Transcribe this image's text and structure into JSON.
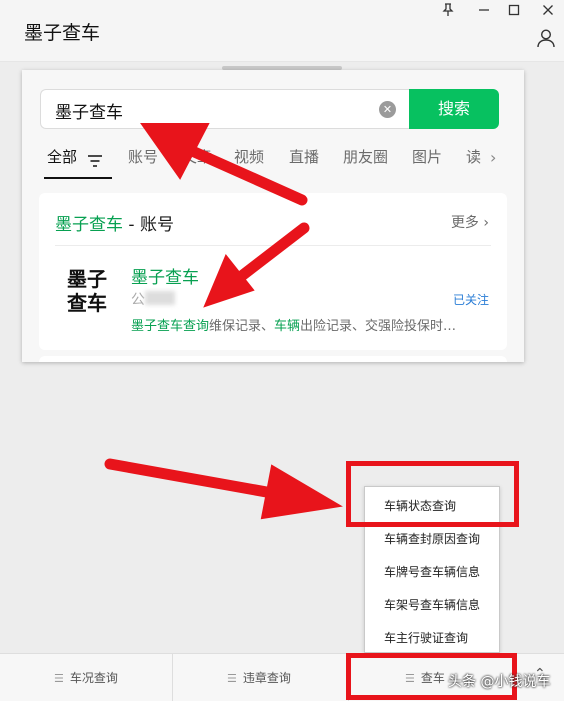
{
  "window": {
    "title": "墨子查车",
    "controls": {
      "pin": "⊥",
      "minimize": "—",
      "maximize": "☐",
      "close": "✕"
    }
  },
  "search": {
    "query": "墨子查车",
    "clear_icon": "clear-icon",
    "button_label": "搜索"
  },
  "tabs": {
    "items": [
      {
        "label": "全部",
        "active": true
      },
      {
        "label": "账号"
      },
      {
        "label": "文章"
      },
      {
        "label": "视频"
      },
      {
        "label": "直播"
      },
      {
        "label": "朋友圈"
      },
      {
        "label": "图片"
      },
      {
        "label": "读"
      }
    ]
  },
  "result_card": {
    "head_highlight": "墨子查车",
    "head_suffix": " - 账号",
    "more_label": "更多",
    "logo_line1": "墨子",
    "logo_line2": "查车",
    "account_name": "墨子查车",
    "account_type": "公",
    "follow_status": "已关注",
    "desc_part1": "墨子查车查询",
    "desc_part2": "维保记录、",
    "desc_part3": "车辆",
    "desc_part4": "出险记录、交强险投保时…"
  },
  "menu": {
    "items": [
      "车辆状态查询",
      "车辆查封原因查询",
      "车牌号查车辆信息",
      "车架号查车辆信息",
      "车主行驶证查询"
    ]
  },
  "bottom_bar": {
    "items": [
      {
        "label": "车况查询"
      },
      {
        "label": "违章查询"
      },
      {
        "label": "查车"
      }
    ]
  },
  "watermark": "头条 @小钱说车",
  "colors": {
    "accent_green": "#07c160",
    "highlight_green": "#07a051",
    "annotation_red": "#e8141b",
    "link_blue": "#2a7dd6"
  }
}
